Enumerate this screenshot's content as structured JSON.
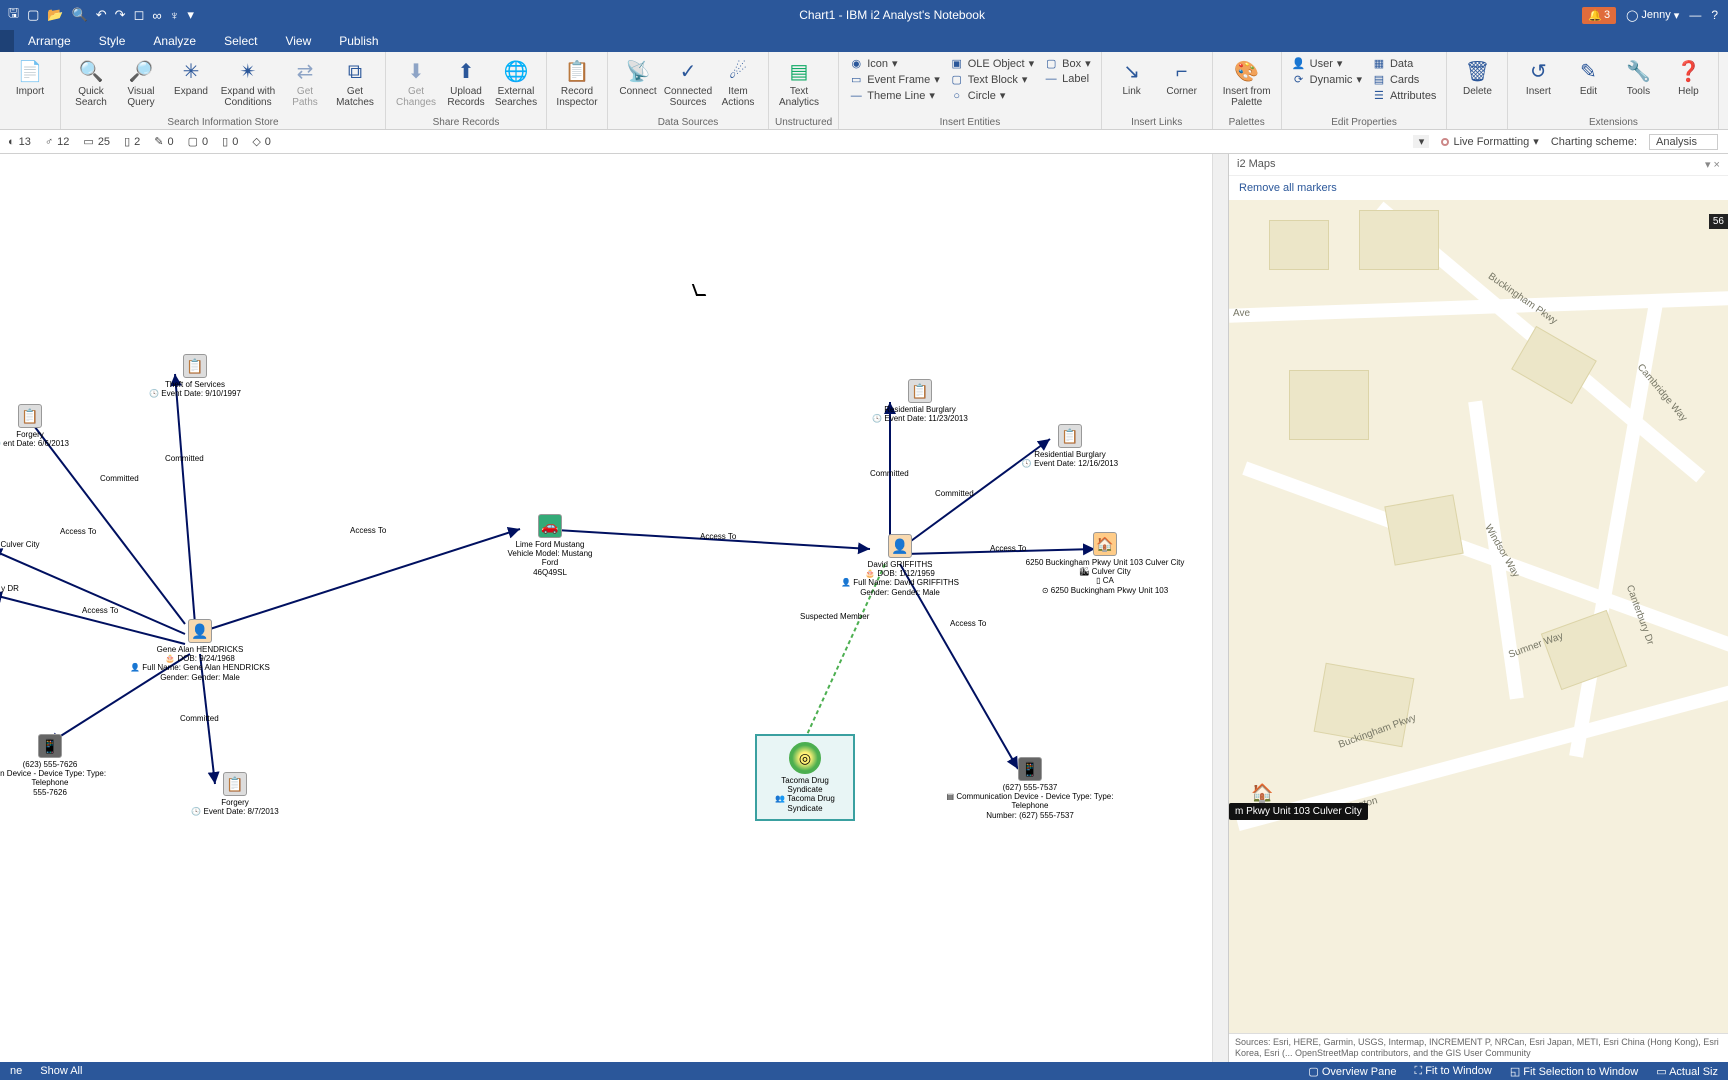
{
  "title": "Chart1 - IBM i2 Analyst's Notebook",
  "notif_count": "3",
  "user_name": "Jenny",
  "tabs": {
    "arrange": "Arrange",
    "style": "Style",
    "analyze": "Analyze",
    "select": "Select",
    "view": "View",
    "publish": "Publish"
  },
  "ribbon": {
    "import": "Import",
    "quick_search": "Quick\nSearch",
    "visual_query": "Visual\nQuery",
    "expand": "Expand",
    "expand_cond": "Expand with\nConditions",
    "get_paths": "Get\nPaths",
    "get_matches": "Get\nMatches",
    "group_search": "Search Information Store",
    "get_changes": "Get\nChanges",
    "upload_records": "Upload\nRecords",
    "external_searches": "External\nSearches",
    "group_share": "Share Records",
    "record_inspector": "Record\nInspector",
    "connect": "Connect",
    "connected_sources": "Connected\nSources",
    "item_actions": "Item\nActions",
    "group_data": "Data Sources",
    "text_analytics": "Text\nAnalytics",
    "unstructured": "Unstructured",
    "icon": "Icon",
    "event_frame": "Event Frame",
    "theme_line": "Theme Line",
    "ole_object": "OLE Object",
    "text_block": "Text Block",
    "circle": "Circle",
    "box": "Box",
    "label": "Label",
    "group_insert_entities": "Insert Entities",
    "link": "Link",
    "corner": "Corner",
    "group_insert_links": "Insert Links",
    "insert_palette": "Insert from\nPalette",
    "group_palettes": "Palettes",
    "user": "User",
    "dynamic": "Dynamic",
    "data": "Data",
    "cards": "Cards",
    "attributes": "Attributes",
    "group_editprops": "Edit Properties",
    "delete": "Delete",
    "insert": "Insert",
    "edit": "Edit",
    "tools": "Tools",
    "help": "Help",
    "group_ext": "Extensions"
  },
  "toolbar2": {
    "v1": "13",
    "v2": "12",
    "v3": "25",
    "v4": "2",
    "v5": "0",
    "v6": "0",
    "v7": "0",
    "v8": "0",
    "live_format": "Live Formatting",
    "charting_scheme_label": "Charting scheme:",
    "charting_scheme_value": "Analysis"
  },
  "map": {
    "pane_title": "i2 Maps",
    "remove_all": "Remove all markers",
    "badge": "56",
    "marker": "m Pkwy Unit 103 Culver City",
    "roads": {
      "ave": "Ave",
      "buckingham": "Buckingham Pkwy",
      "cambridge": "Cambridge Way",
      "windsor": "Windsor Way",
      "canterbury": "Canterbury Dr",
      "sumner": "Sumner Way",
      "buckingham2": "Buckingham Pkwy",
      "kensington": "Kensington"
    },
    "attribution": "Sources: Esri, HERE, Garmin, USGS, Intermap, INCREMENT P, NRCan, Esri Japan, METI, Esri China (Hong Kong), Esri Korea, Esri (... OpenStreetMap contributors, and the GIS User Community"
  },
  "statusbar": {
    "left1": "ne",
    "left2": "Show All",
    "r1": "Overview Pane",
    "r2": "Fit to Window",
    "r3": "Fit Selection to Window",
    "r4": "Actual Siz"
  },
  "chart": {
    "theft": {
      "title": "Theft of Services",
      "date": "Event Date: 9/10/1997"
    },
    "forgery1": {
      "title": "Forgery",
      "date": "ent Date: 6/6/2013"
    },
    "forgery2": {
      "title": "Forgery",
      "date": "Event Date: 8/7/2013"
    },
    "resburg1": {
      "title": "Residential Burglary",
      "date": "Event Date: 11/23/2013"
    },
    "resburg2": {
      "title": "Residential Burglary",
      "date": "Event Date: 12/16/2013"
    },
    "gene": {
      "title": "Gene Alan HENDRICKS",
      "dob": "DOB: 9/24/1968",
      "full": "Full Name: Gene Alan HENDRICKS",
      "gender": "Gender: Gender: Male"
    },
    "david": {
      "title": "David GRIFFITHS",
      "dob": "DOB: 1/12/1959",
      "full": "Full Name: David GRIFFITHS",
      "gender": "Gender: Gender: Male"
    },
    "vehicle": {
      "title": "Lime Ford Mustang",
      "model": "Vehicle Model: Mustang",
      "make": "Ford",
      "plate": "46Q49SL"
    },
    "house": {
      "title": "6250 Buckingham Pkwy Unit 103 Culver City",
      "city": "Culver City",
      "state": "CA",
      "addr": "6250 Buckingham Pkwy Unit 103"
    },
    "phone1": {
      "title": "(623) 555-7626",
      "desc": "ion Device - Device Type: Type: Telephone",
      "num": "555-7626"
    },
    "phone2": {
      "title": "(627) 555-7537",
      "desc": "Communication Device - Device Type: Type: Telephone",
      "num": "Number: (627) 555-7537"
    },
    "syndicate": {
      "title": "Tacoma Drug Syndicate",
      "sub": "Tacoma Drug Syndicate"
    },
    "culver": "Culver City",
    "ydr": "y DR",
    "links": {
      "committed": "Committed",
      "access_to": "Access To",
      "suspected": "Suspected Member"
    }
  }
}
